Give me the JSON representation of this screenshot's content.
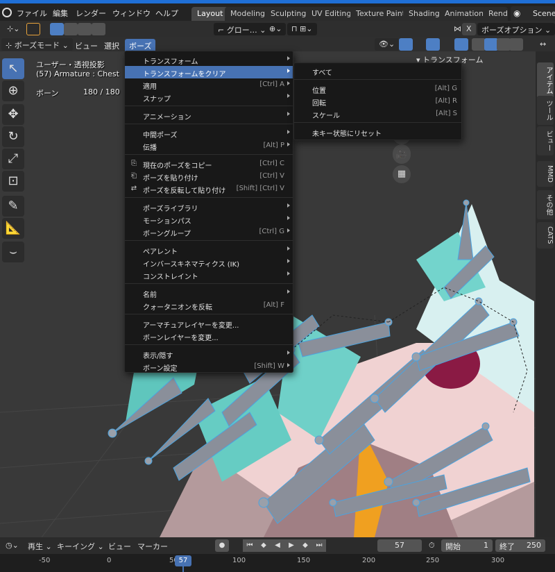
{
  "topbar": {
    "menus": [
      "ファイル",
      "編集",
      "レンダー",
      "ウィンドウ",
      "ヘルプ"
    ],
    "tabs": [
      "Layout",
      "Modeling",
      "Sculpting",
      "UV Editing",
      "Texture Paint",
      "Shading",
      "Animation",
      "Rende"
    ],
    "active_tab": "Layout",
    "scene": "Scene"
  },
  "tool_header": {
    "transform_orientation": "グロー…",
    "x_label": "X",
    "pose_options": "ボーズオプション"
  },
  "editor_header": {
    "mode": "ボーズモード",
    "menus": [
      "ビュー",
      "選択",
      "ボーズ"
    ],
    "active_menu": "ボーズ"
  },
  "viewport": {
    "view_label": "ユーザー・透視投影",
    "object_label": "(57) Armature : Chest",
    "bones_label": "ボーン",
    "bones_count": "180 / 180"
  },
  "pose_menu": {
    "items": [
      {
        "label": "トランスフォーム",
        "shortcut": "",
        "submenu": true
      },
      {
        "label": "トランスフォームをクリア",
        "shortcut": "",
        "submenu": true,
        "highlighted": true
      },
      {
        "label": "適用",
        "shortcut": "[Ctrl] A",
        "submenu": true
      },
      {
        "label": "スナップ",
        "shortcut": "",
        "submenu": true
      },
      {
        "label": "アニメーション",
        "shortcut": "",
        "submenu": true
      },
      {
        "label": "中間ポーズ",
        "shortcut": "",
        "submenu": true
      },
      {
        "label": "伝播",
        "shortcut": "[Alt] P",
        "submenu": true
      },
      {
        "label": "現在のポーズをコピー",
        "shortcut": "[Ctrl] C",
        "submenu": false,
        "icon": "copy-icon"
      },
      {
        "label": "ポーズを貼り付け",
        "shortcut": "[Ctrl] V",
        "submenu": false,
        "icon": "paste-icon"
      },
      {
        "label": "ポーズを反転して貼り付け",
        "shortcut": "[Shift] [Ctrl] V",
        "submenu": false,
        "icon": "paste-flipped-icon"
      },
      {
        "label": "ポーズライブラリ",
        "shortcut": "",
        "submenu": true
      },
      {
        "label": "モーションパス",
        "shortcut": "",
        "submenu": true
      },
      {
        "label": "ボーングループ",
        "shortcut": "[Ctrl] G",
        "submenu": true
      },
      {
        "label": "ペアレント",
        "shortcut": "",
        "submenu": true
      },
      {
        "label": "インバースキネマティクス (IK)",
        "shortcut": "",
        "submenu": true
      },
      {
        "label": "コンストレイント",
        "shortcut": "",
        "submenu": true
      },
      {
        "label": "名前",
        "shortcut": "",
        "submenu": true
      },
      {
        "label": "クォータニオンを反転",
        "shortcut": "[Alt] F",
        "submenu": false
      },
      {
        "label": "アーマチュアレイヤーを変更...",
        "shortcut": "",
        "submenu": false
      },
      {
        "label": "ボーンレイヤーを変更...",
        "shortcut": "",
        "submenu": false
      },
      {
        "label": "表示/隠す",
        "shortcut": "",
        "submenu": true
      },
      {
        "label": "ボーン設定",
        "shortcut": "[Shift] W",
        "submenu": true
      }
    ]
  },
  "clear_transform_submenu": {
    "items": [
      {
        "label": "すべて",
        "shortcut": ""
      },
      {
        "label": "位置",
        "shortcut": "[Alt] G"
      },
      {
        "label": "回転",
        "shortcut": "[Alt] R"
      },
      {
        "label": "スケール",
        "shortcut": "[Alt] S"
      },
      {
        "label": "未キー状態にリセット",
        "shortcut": ""
      }
    ]
  },
  "sidebar": {
    "panel_title": "トランスフォーム",
    "tabs": [
      "アイテム",
      "ツール",
      "ビュー",
      "MMD",
      "その他",
      "CATS"
    ],
    "active_tab": "アイテム"
  },
  "timeline": {
    "playback": "再生",
    "keying": "キーイング",
    "view": "ビュー",
    "marker": "マーカー",
    "current_frame": "57",
    "start_label": "開始",
    "start_value": "1",
    "end_label": "終了",
    "end_value": "250",
    "ruler_ticks": [
      "-50",
      "0",
      "50",
      "100",
      "150",
      "200",
      "250",
      "300"
    ],
    "playhead": "57"
  },
  "colors": {
    "accent": "#4772b3",
    "menu_bg": "#181818",
    "bone_fill": "#8a8f9a",
    "bone_outline": "#4aa3e0",
    "hair": "#8fe0dc"
  }
}
